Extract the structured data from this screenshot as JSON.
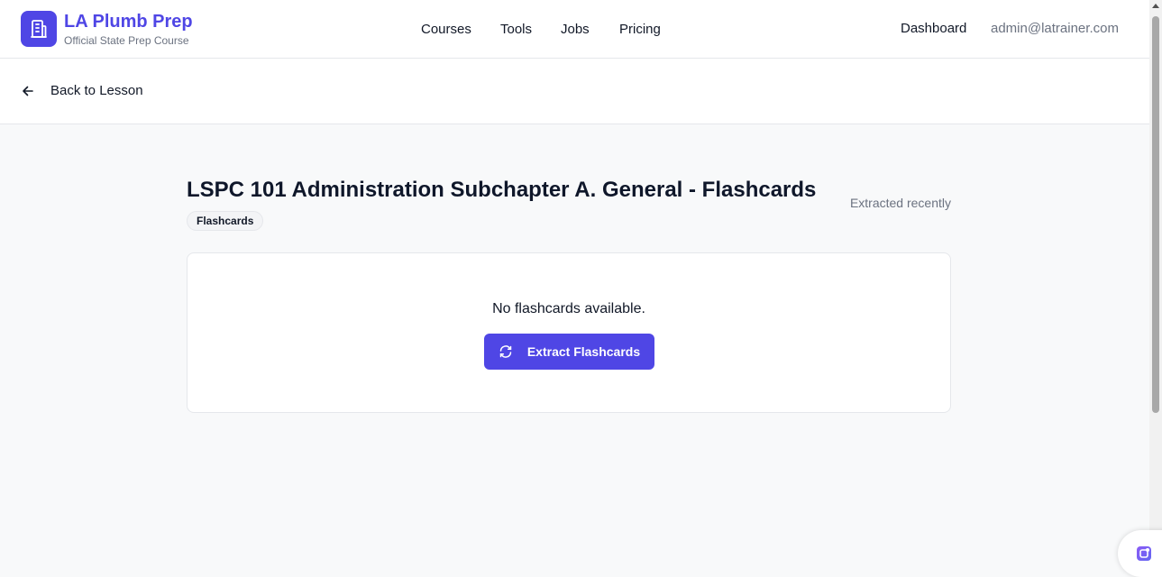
{
  "header": {
    "brand_title": "LA Plumb Prep",
    "brand_subtitle": "Official State Prep Course",
    "logo_icon": "building-icon",
    "nav": [
      "Courses",
      "Tools",
      "Jobs",
      "Pricing"
    ],
    "dashboard_label": "Dashboard",
    "user_email": "admin@latrainer.com"
  },
  "subbar": {
    "back_label": "Back to Lesson",
    "back_icon": "arrow-left-icon"
  },
  "main": {
    "title": "LSPC 101 Administration Subchapter A. General - Flashcards",
    "tag": "Flashcards",
    "extracted_status": "Extracted recently",
    "empty_message": "No flashcards available.",
    "extract_button_label": "Extract Flashcards",
    "extract_button_icon": "refresh-icon"
  },
  "colors": {
    "accent": "#4f46e5",
    "muted_text": "#6b7280",
    "border": "#e5e7eb",
    "page_background": "#f8f9fa"
  }
}
